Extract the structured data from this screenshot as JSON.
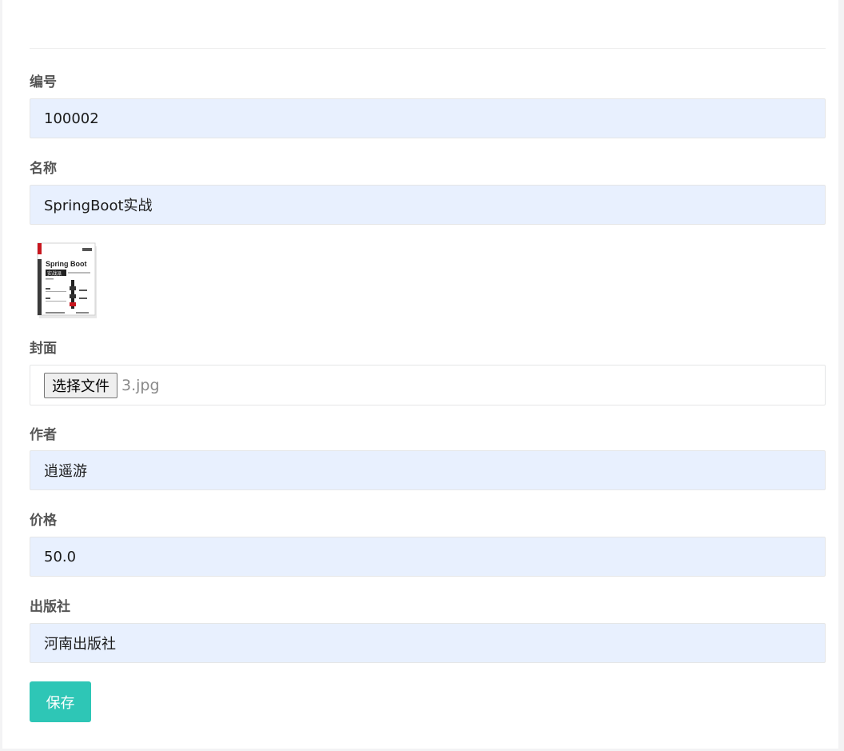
{
  "form": {
    "id": {
      "label": "编号",
      "value": "100002"
    },
    "name": {
      "label": "名称",
      "value": "SpringBoot实战"
    },
    "cover": {
      "label": "封面",
      "choose_button_label": "选择文件",
      "file_name": "3.jpg",
      "image_title": "Spring Boot",
      "image_subtitle": "实战派"
    },
    "author": {
      "label": "作者",
      "value": "逍遥游"
    },
    "price": {
      "label": "价格",
      "value": "50.0"
    },
    "publisher": {
      "label": "出版社",
      "value": "河南出版社"
    },
    "save_label": "保存"
  },
  "colors": {
    "input_background": "#e8f0fe",
    "accent": "#2ec6b6",
    "label_text": "#555555"
  }
}
